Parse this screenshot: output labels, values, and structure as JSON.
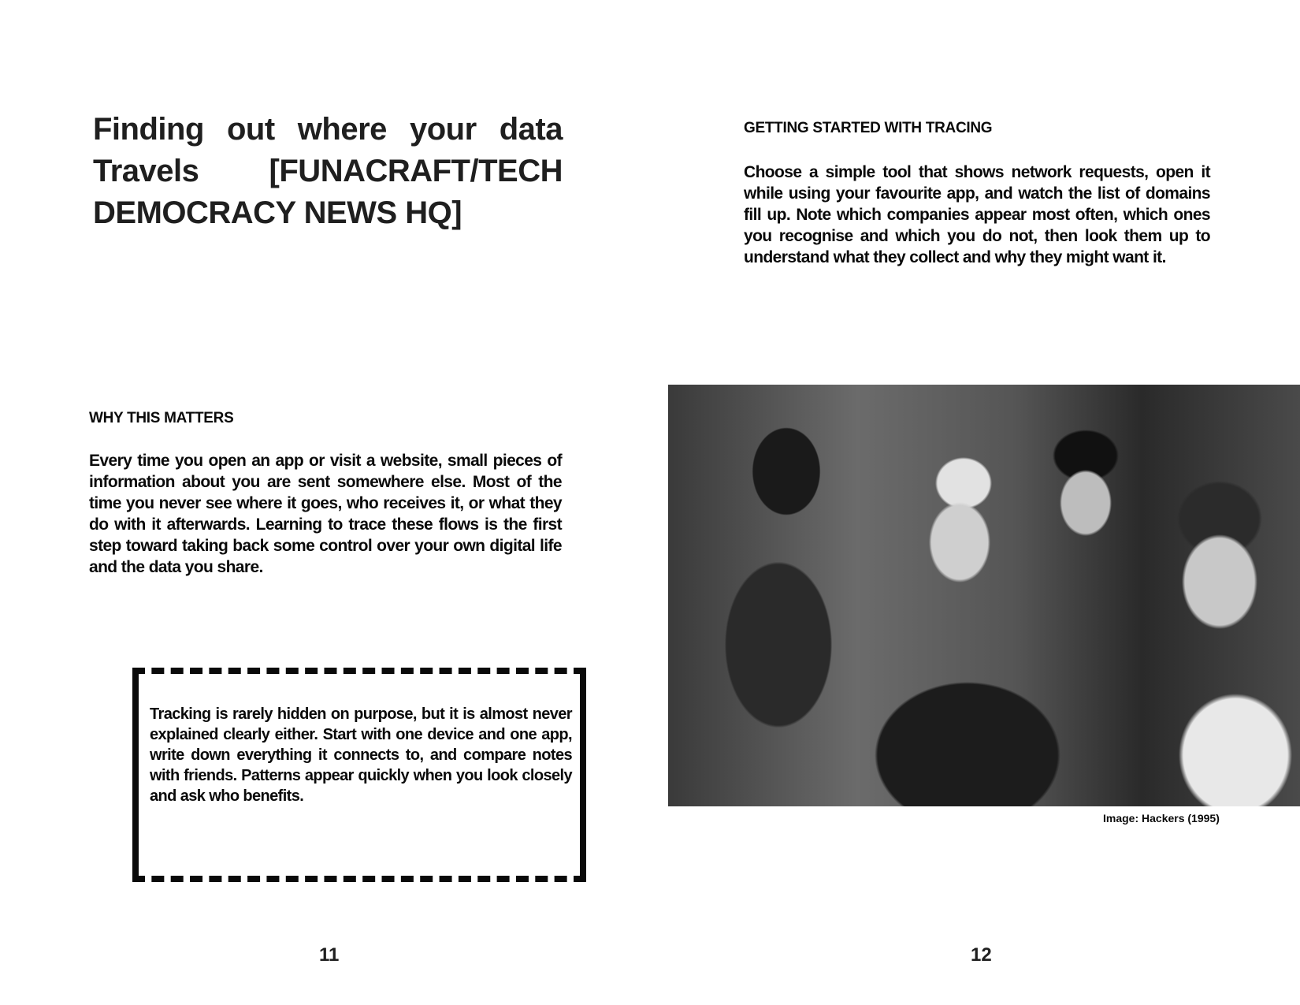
{
  "left_page": {
    "title": "Finding out where your data Travels [FUNACRAFT/TECH DEMOCRACY NEWS HQ]",
    "section_heading": "Why this matters",
    "section_body": "Every time you open an app or visit a website, small pieces of information about you are sent somewhere else. Most of the time you never see where it goes, who receives it, or what they do with it afterwards. Learning to trace these flows is the first step toward taking back some control over your own digital life and the data you share.",
    "callout_body": "Tracking is rarely hidden on purpose, but it is almost never explained clearly either. Start with one device and one app, write down everything it connects to, and compare notes with friends. Patterns appear quickly when you look closely and ask who benefits.",
    "page_number": "11"
  },
  "right_page": {
    "section_heading": "Getting started with tracing",
    "section_body": "Choose a simple tool that shows network requests, open it while using your favourite app, and watch the list of domains fill up. Note which companies appear most often, which ones you recognise and which you do not, then look them up to understand what they collect and why they might want it.",
    "photo_caption": "Image: Hackers (1995)",
    "page_number": "12"
  }
}
